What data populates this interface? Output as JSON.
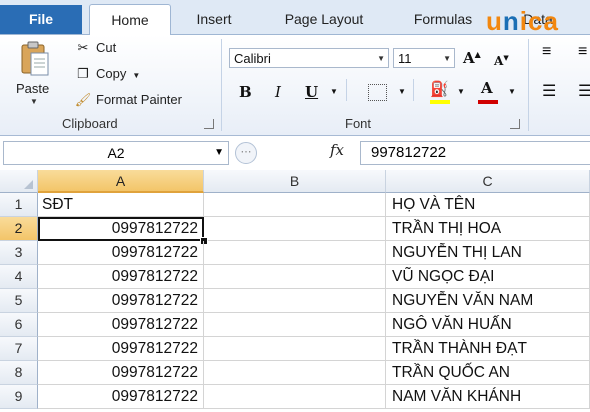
{
  "tabs": {
    "file": "File",
    "home": "Home",
    "insert": "Insert",
    "page_layout": "Page Layout",
    "formulas": "Formulas",
    "data": "Data"
  },
  "logo": {
    "prefix": "u",
    "mid": "n",
    "rest": "ica"
  },
  "clipboard": {
    "paste": "Paste",
    "cut": "Cut",
    "copy": "Copy",
    "format_painter": "Format Painter",
    "label": "Clipboard"
  },
  "font": {
    "name": "Calibri",
    "size": "11",
    "label": "Font",
    "grow": "A",
    "shrink": "A",
    "bold": "B",
    "italic": "I",
    "underline": "U",
    "font_color": "A"
  },
  "formula_bar": {
    "name_box": "A2",
    "fx": "fx",
    "value": "997812722"
  },
  "columns": [
    "A",
    "B",
    "C"
  ],
  "rows": [
    {
      "num": "1",
      "a": "SĐT",
      "b": "",
      "c": "HỌ VÀ TÊN"
    },
    {
      "num": "2",
      "a": "0997812722",
      "b": "",
      "c": "TRẦN THỊ HOA"
    },
    {
      "num": "3",
      "a": "0997812722",
      "b": "",
      "c": "NGUYỄN THỊ LAN"
    },
    {
      "num": "4",
      "a": "0997812722",
      "b": "",
      "c": "VŨ NGỌC ĐẠI"
    },
    {
      "num": "5",
      "a": "0997812722",
      "b": "",
      "c": "NGUYỄN VĂN NAM"
    },
    {
      "num": "6",
      "a": "0997812722",
      "b": "",
      "c": "NGÔ VĂN HUẤN"
    },
    {
      "num": "7",
      "a": "0997812722",
      "b": "",
      "c": "TRẦN THÀNH ĐẠT"
    },
    {
      "num": "8",
      "a": "0997812722",
      "b": "",
      "c": "TRẦN QUỐC AN"
    },
    {
      "num": "9",
      "a": "0997812722",
      "b": "",
      "c": "NAM VĂN KHÁNH"
    }
  ],
  "colors": {
    "file_tab": "#2a6db5",
    "logo_orange": "#f2870f",
    "logo_blue": "#1b6fb5",
    "font_color_bar": "#d00000",
    "highlight_bar": "#ffff00"
  }
}
